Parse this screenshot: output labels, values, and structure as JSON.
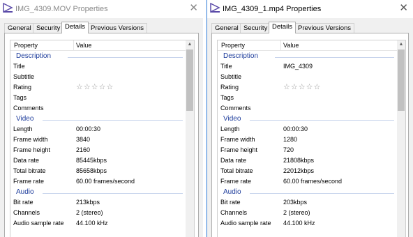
{
  "left_window": {
    "title": "IMG_4309.MOV Properties",
    "close_glyph": "✕",
    "tabs": [
      "General",
      "Security",
      "Details",
      "Previous Versions"
    ],
    "active_tab": "Details",
    "header": {
      "property": "Property",
      "value": "Value"
    },
    "scroll_up_glyph": "▲",
    "rows": [
      {
        "section": "Description"
      },
      {
        "label": "Title",
        "value": ""
      },
      {
        "label": "Subtitle",
        "value": ""
      },
      {
        "label": "Rating",
        "rating": "☆☆☆☆☆"
      },
      {
        "label": "Tags",
        "value": ""
      },
      {
        "label": "Comments",
        "value": ""
      },
      {
        "section": "Video"
      },
      {
        "label": "Length",
        "value": "00:00:30"
      },
      {
        "label": "Frame width",
        "value": "3840"
      },
      {
        "label": "Frame height",
        "value": "2160"
      },
      {
        "label": "Data rate",
        "value": "85445kbps"
      },
      {
        "label": "Total bitrate",
        "value": "85658kbps"
      },
      {
        "label": "Frame rate",
        "value": "60.00 frames/second"
      },
      {
        "section": "Audio"
      },
      {
        "label": "Bit rate",
        "value": "213kbps"
      },
      {
        "label": "Channels",
        "value": "2 (stereo)"
      },
      {
        "label": "Audio sample rate",
        "value": "44.100 kHz"
      }
    ]
  },
  "right_window": {
    "title": "IMG_4309_1.mp4 Properties",
    "close_glyph": "✕",
    "tabs": [
      "General",
      "Security",
      "Details",
      "Previous Versions"
    ],
    "active_tab": "Details",
    "header": {
      "property": "Property",
      "value": "Value"
    },
    "scroll_up_glyph": "▲",
    "rows": [
      {
        "section": "Description"
      },
      {
        "label": "Title",
        "value": "IMG_4309"
      },
      {
        "label": "Subtitle",
        "value": ""
      },
      {
        "label": "Rating",
        "rating": "☆☆☆☆☆"
      },
      {
        "label": "Tags",
        "value": ""
      },
      {
        "label": "Comments",
        "value": ""
      },
      {
        "section": "Video"
      },
      {
        "label": "Length",
        "value": "00:00:30"
      },
      {
        "label": "Frame width",
        "value": "1280"
      },
      {
        "label": "Frame height",
        "value": "720"
      },
      {
        "label": "Data rate",
        "value": "21808kbps"
      },
      {
        "label": "Total bitrate",
        "value": "22012kbps"
      },
      {
        "label": "Frame rate",
        "value": "60.00 frames/second"
      },
      {
        "section": "Audio"
      },
      {
        "label": "Bit rate",
        "value": "203kbps"
      },
      {
        "label": "Channels",
        "value": "2 (stereo)"
      },
      {
        "label": "Audio sample rate",
        "value": "44.100 kHz"
      }
    ]
  }
}
